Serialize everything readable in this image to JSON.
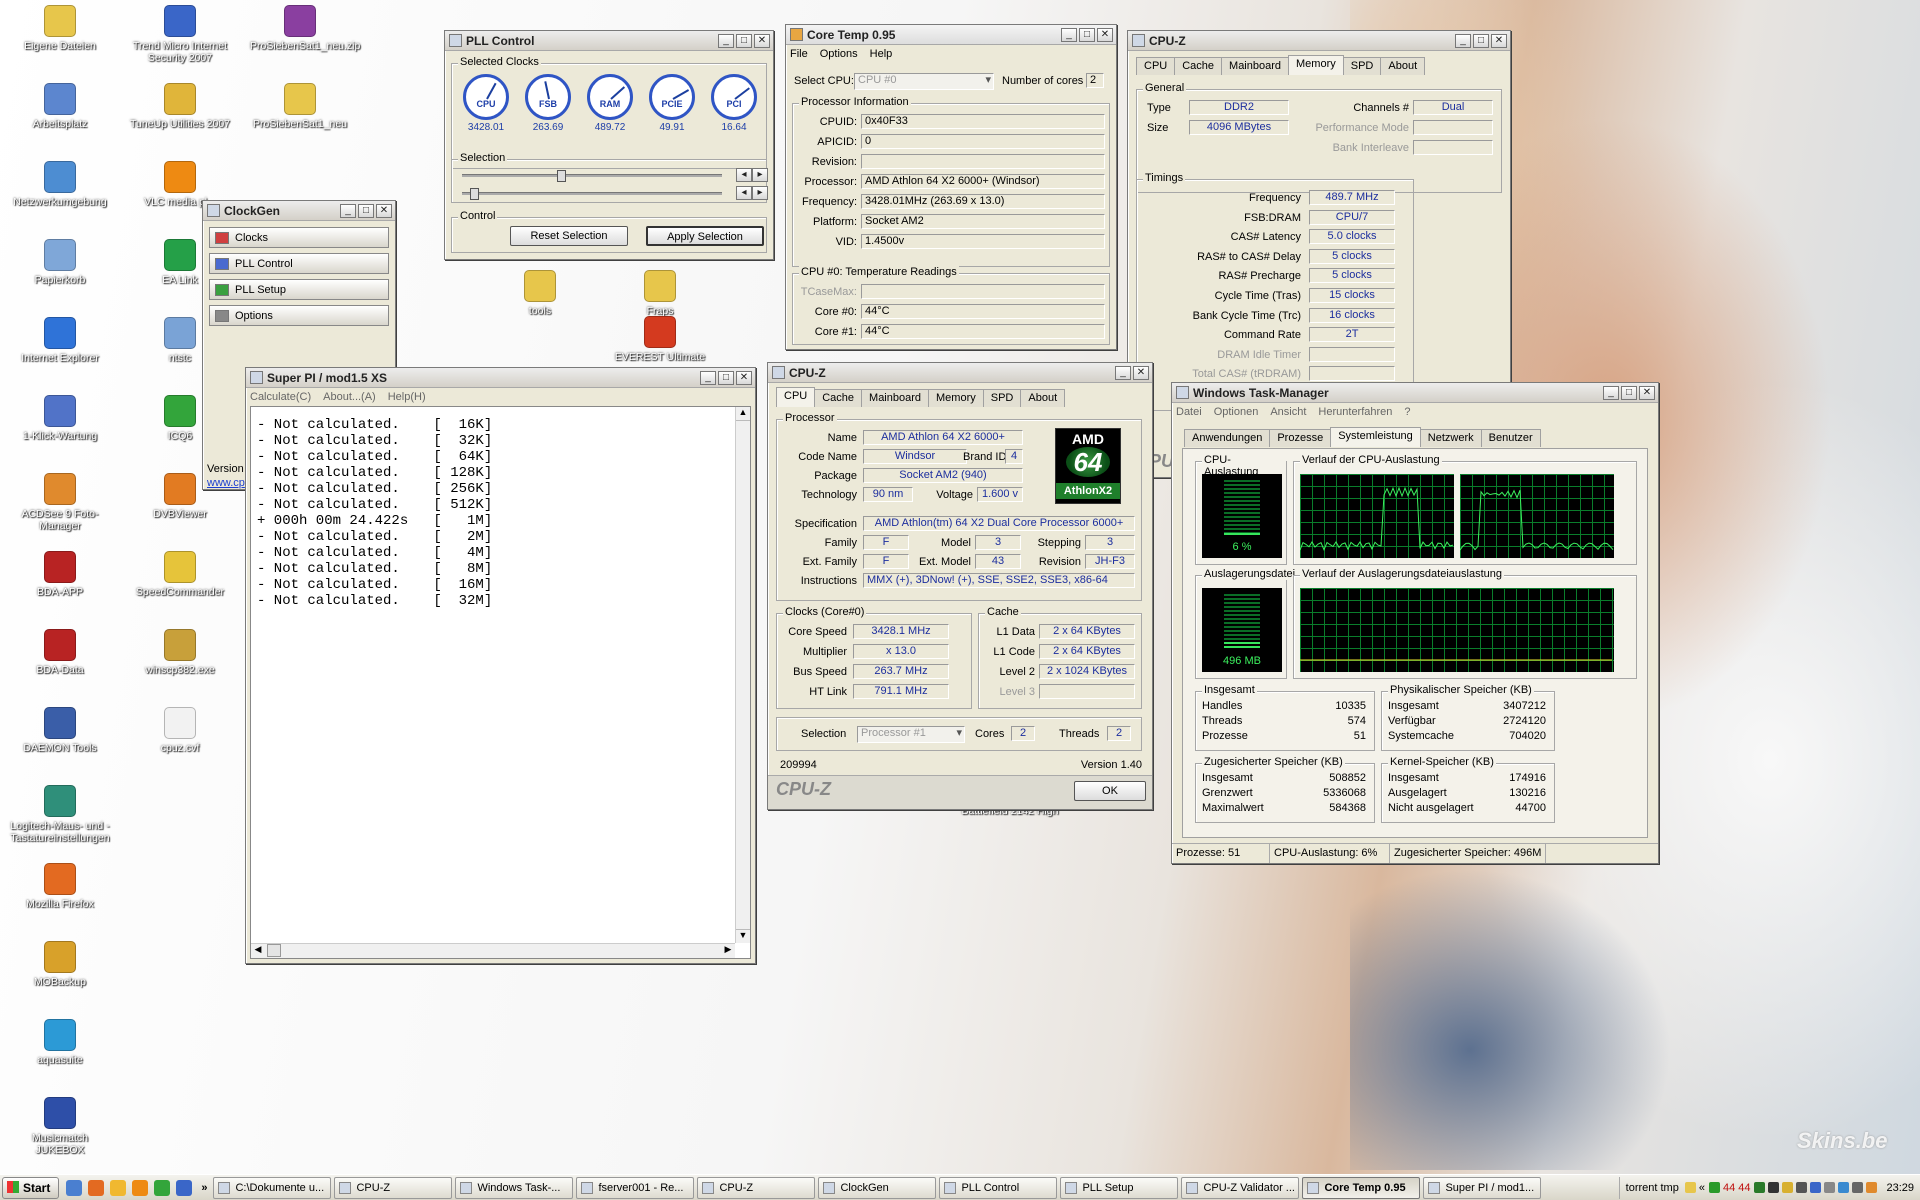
{
  "desktop": {
    "icons": [
      {
        "label": "Eigene Dateien",
        "color": "#e7c64b",
        "glyph": "folder-icon"
      },
      {
        "label": "Arbeitsplatz",
        "color": "#5c86cf",
        "glyph": "computer-icon"
      },
      {
        "label": "Netzwerkumgebung",
        "color": "#4d8dd2",
        "glyph": "network-icon"
      },
      {
        "label": "Papierkorb",
        "color": "#7fa7d8",
        "glyph": "recycle-bin-icon"
      },
      {
        "label": "Internet Explorer",
        "color": "#2f73d8",
        "glyph": "ie-icon"
      },
      {
        "label": "1-Klick-Wartung",
        "color": "#5173c8",
        "glyph": "wrench-icon"
      },
      {
        "label": "ACDSee 9 Foto-Manager",
        "color": "#e08a2d",
        "glyph": "photo-icon"
      },
      {
        "label": "BDA-APP",
        "color": "#b82323",
        "glyph": "app-icon"
      },
      {
        "label": "BDA-Data",
        "color": "#b82323",
        "glyph": "app-icon"
      },
      {
        "label": "DAEMON Tools",
        "color": "#3a5ea8",
        "glyph": "daemon-icon"
      },
      {
        "label": "Logitech-Maus- und -Tastatureinstellungen",
        "color": "#2f8f7a",
        "glyph": "mouse-icon"
      },
      {
        "label": "Mozilla Firefox",
        "color": "#e36a21",
        "glyph": "firefox-icon"
      },
      {
        "label": "MOBackup",
        "color": "#d8a12a",
        "glyph": "backup-icon"
      },
      {
        "label": "aquasuite",
        "color": "#2c9ad6",
        "glyph": "aqua-icon"
      },
      {
        "label": "Musicmatch JUKEBOX",
        "color": "#2e4fa8",
        "glyph": "music-icon"
      },
      {
        "label": "Trend Micro Internet Security 2007",
        "color": "#3a66c8",
        "glyph": "shield-icon"
      },
      {
        "label": "TuneUp Utilities 2007",
        "color": "#e0b53a",
        "glyph": "tuneup-icon"
      },
      {
        "label": "VLC media pl...",
        "color": "#ee8a12",
        "glyph": "vlc-icon"
      },
      {
        "label": "EA Link",
        "color": "#25a048",
        "glyph": "ea-icon"
      },
      {
        "label": "ntstc",
        "color": "#7aa3d6",
        "glyph": "app-icon"
      },
      {
        "label": "ICQ6",
        "color": "#33a53b",
        "glyph": "icq-icon"
      },
      {
        "label": "DVBViewer",
        "color": "#e27b22",
        "glyph": "tv-icon"
      },
      {
        "label": "SpeedCommander",
        "color": "#e6c43a",
        "glyph": "speed-icon"
      },
      {
        "label": "winscp382.exe",
        "color": "#c8a03a",
        "glyph": "exe-icon"
      },
      {
        "label": "cpuz.cvf",
        "color": "#f2f2f2",
        "glyph": "file-icon"
      },
      {
        "label": "ProSiebenSat1_neu.zip",
        "color": "#8a3fa0",
        "glyph": "zip-icon"
      },
      {
        "label": "ProSiebenSat1_neu",
        "color": "#e7c64b",
        "glyph": "folder-icon"
      },
      {
        "label": "tools",
        "color": "#e7c64b",
        "glyph": "folder-icon"
      },
      {
        "label": "Fraps",
        "color": "#e7c64b",
        "glyph": "fraps-icon"
      },
      {
        "label": "EVEREST Ultimate",
        "color": "#d43a1f",
        "glyph": "everest-icon"
      },
      {
        "label": "Battlefield 2142 High",
        "color": "#6a6a6a",
        "glyph": "game-icon"
      }
    ],
    "watermark": "Skins.be"
  },
  "pll": {
    "title": "PLL Control",
    "selected_clocks": "Selected Clocks",
    "gauges": [
      {
        "label": "CPU",
        "value": "3428.01",
        "level": 0.62
      },
      {
        "label": "FSB",
        "value": "263.69",
        "level": 0.45
      },
      {
        "label": "RAM",
        "value": "489.72",
        "level": 0.7
      },
      {
        "label": "PCIE",
        "value": "49.91",
        "level": 0.75
      },
      {
        "label": "PCI",
        "value": "16.64",
        "level": 0.72
      }
    ],
    "selection": "Selection",
    "control": "Control",
    "reset": "Reset Selection",
    "apply": "Apply Selection",
    "slider1": 0.38,
    "slider2": 0.03
  },
  "clockgen": {
    "title": "ClockGen",
    "items": [
      "Clocks",
      "PLL Control",
      "PLL Setup",
      "Options"
    ],
    "version": "Version",
    "link": "www.cp"
  },
  "coretemp": {
    "title": "Core Temp 0.95",
    "menu": [
      "File",
      "Options",
      "Help"
    ],
    "select_cpu": "Select CPU:",
    "cpu_value": "CPU #0",
    "num_cores": "Number of cores",
    "cores": "2",
    "proc_info": "Processor Information",
    "rows": [
      {
        "k": "CPUID:",
        "v": "0x40F33"
      },
      {
        "k": "APICID:",
        "v": "0"
      },
      {
        "k": "Revision:",
        "v": ""
      },
      {
        "k": "Processor:",
        "v": "AMD Athlon 64 X2 6000+ (Windsor)"
      },
      {
        "k": "Frequency:",
        "v": "3428.01MHz (263.69 x 13.0)"
      },
      {
        "k": "Platform:",
        "v": "Socket AM2"
      },
      {
        "k": "VID:",
        "v": "1.4500v"
      }
    ],
    "temps_title": "CPU #0: Temperature Readings",
    "temps": [
      {
        "k": "TCaseMax:",
        "v": ""
      },
      {
        "k": "Core #0:",
        "v": "44°C"
      },
      {
        "k": "Core #1:",
        "v": "44°C"
      }
    ]
  },
  "cpuz_mem": {
    "title": "CPU-Z",
    "tabs": [
      "CPU",
      "Cache",
      "Mainboard",
      "Memory",
      "SPD",
      "About"
    ],
    "general": "General",
    "type_k": "Type",
    "type_v": "DDR2",
    "size_k": "Size",
    "size_v": "4096 MBytes",
    "channels_k": "Channels #",
    "channels_v": "Dual",
    "perf_k": "Performance Mode",
    "bank_k": "Bank Interleave",
    "timings": "Timings",
    "rows": [
      {
        "k": "Frequency",
        "v": "489.7 MHz"
      },
      {
        "k": "FSB:DRAM",
        "v": "CPU/7"
      },
      {
        "k": "CAS# Latency",
        "v": "5.0 clocks"
      },
      {
        "k": "RAS# to CAS# Delay",
        "v": "5 clocks"
      },
      {
        "k": "RAS# Precharge",
        "v": "5 clocks"
      },
      {
        "k": "Cycle Time (Tras)",
        "v": "15 clocks"
      },
      {
        "k": "Bank Cycle Time (Trc)",
        "v": "16 clocks"
      },
      {
        "k": "Command Rate",
        "v": "2T"
      },
      {
        "k": "DRAM Idle Timer",
        "v": ""
      },
      {
        "k": "Total CAS# (tRDRAM)",
        "v": ""
      }
    ],
    "footer": "CPU"
  },
  "superpi": {
    "title": "Super PI / mod1.5 XS",
    "menu": [
      "Calculate(C)",
      "About...(A)",
      "Help(H)"
    ],
    "lines": [
      "- Not calculated.    [  16K]",
      "- Not calculated.    [  32K]",
      "- Not calculated.    [  64K]",
      "- Not calculated.    [ 128K]",
      "- Not calculated.    [ 256K]",
      "- Not calculated.    [ 512K]",
      "+ 000h 00m 24.422s   [   1M]",
      "- Not calculated.    [   2M]",
      "- Not calculated.    [   4M]",
      "- Not calculated.    [   8M]",
      "- Not calculated.    [  16M]",
      "- Not calculated.    [  32M]"
    ]
  },
  "cpuz": {
    "title": "CPU-Z",
    "tabs": [
      "CPU",
      "Cache",
      "Mainboard",
      "Memory",
      "SPD",
      "About"
    ],
    "processor": "Processor",
    "name_k": "Name",
    "name_v": "AMD Athlon 64 X2 6000+",
    "code_k": "Code Name",
    "code_v": "Windsor",
    "brand_k": "Brand ID",
    "brand_v": "4",
    "pkg_k": "Package",
    "pkg_v": "Socket AM2 (940)",
    "tech_k": "Technology",
    "tech_v": "90 nm",
    "volt_k": "Voltage",
    "volt_v": "1.600 v",
    "spec_k": "Specification",
    "spec_v": "AMD Athlon(tm) 64 X2 Dual Core Processor 6000+",
    "fam_k": "Family",
    "fam_v": "F",
    "model_k": "Model",
    "model_v": "3",
    "step_k": "Stepping",
    "step_v": "3",
    "efam_k": "Ext. Family",
    "efam_v": "F",
    "emodel_k": "Ext. Model",
    "emodel_v": "43",
    "rev_k": "Revision",
    "rev_v": "JH-F3",
    "inst_k": "Instructions",
    "inst_v": "MMX (+), 3DNow! (+), SSE, SSE2, SSE3, x86-64",
    "clocks": "Clocks (Core#0)",
    "core_k": "Core Speed",
    "core_v": "3428.1 MHz",
    "mult_k": "Multiplier",
    "mult_v": "x 13.0",
    "bus_k": "Bus Speed",
    "bus_v": "263.7 MHz",
    "ht_k": "HT Link",
    "ht_v": "791.1 MHz",
    "cache": "Cache",
    "l1d_k": "L1 Data",
    "l1d_v": "2 x 64 KBytes",
    "l1c_k": "L1 Code",
    "l1c_v": "2 x 64 KBytes",
    "l2_k": "Level 2",
    "l2_v": "2 x 1024 KBytes",
    "l3_k": "Level 3",
    "l3_v": "",
    "sel_k": "Selection",
    "sel_v": "Processor #1",
    "cores_k": "Cores",
    "cores_v": "2",
    "threads_k": "Threads",
    "threads_v": "2",
    "id": "209994",
    "version": "Version 1.40",
    "brand": "CPU-Z",
    "ok": "OK",
    "logo_top": "AMD",
    "logo_mid": "64",
    "logo_bot": "AthlonX2"
  },
  "taskmgr": {
    "title": "Windows Task-Manager",
    "menu": [
      "Datei",
      "Optionen",
      "Ansicht",
      "Herunterfahren",
      "?"
    ],
    "tabs": [
      "Anwendungen",
      "Prozesse",
      "Systemleistung",
      "Netzwerk",
      "Benutzer"
    ],
    "cpu_usage": "CPU-Auslastung",
    "cpu_val": "6 %",
    "cpu_level": 0.06,
    "cpu_hist": "Verlauf der CPU-Auslastung",
    "pf": "Auslagerungsdatei",
    "pf_val": "496 MB",
    "pf_level": 0.14,
    "pf_hist": "Verlauf der Auslagerungsdateiauslastung",
    "totals": {
      "title": "Insgesamt",
      "rows": [
        {
          "k": "Handles",
          "v": "10335"
        },
        {
          "k": "Threads",
          "v": "574"
        },
        {
          "k": "Prozesse",
          "v": "51"
        }
      ]
    },
    "phys": {
      "title": "Physikalischer Speicher (KB)",
      "rows": [
        {
          "k": "Insgesamt",
          "v": "3407212"
        },
        {
          "k": "Verfügbar",
          "v": "2724120"
        },
        {
          "k": "Systemcache",
          "v": "704020"
        }
      ]
    },
    "commit": {
      "title": "Zugesicherter Speicher (KB)",
      "rows": [
        {
          "k": "Insgesamt",
          "v": "508852"
        },
        {
          "k": "Grenzwert",
          "v": "5336068"
        },
        {
          "k": "Maximalwert",
          "v": "584368"
        }
      ]
    },
    "kernel": {
      "title": "Kernel-Speicher (KB)",
      "rows": [
        {
          "k": "Insgesamt",
          "v": "174916"
        },
        {
          "k": "Ausgelagert",
          "v": "130216"
        },
        {
          "k": "Nicht ausgelagert",
          "v": "44700"
        }
      ]
    },
    "status": [
      "Prozesse: 51",
      "CPU-Auslastung: 6%",
      "Zugesicherter Speicher: 496M"
    ]
  },
  "taskbar": {
    "start": "Start",
    "tasks": [
      {
        "label": "C:\\Dokumente u...",
        "active": false
      },
      {
        "label": "CPU-Z",
        "active": false
      },
      {
        "label": "Windows Task-...",
        "active": false
      },
      {
        "label": "fserver001 - Re...",
        "active": false
      },
      {
        "label": "CPU-Z",
        "active": false
      },
      {
        "label": "ClockGen",
        "active": false
      },
      {
        "label": "PLL Control",
        "active": false
      },
      {
        "label": "PLL Setup",
        "active": false
      },
      {
        "label": "CPU-Z Validator ...",
        "active": false
      },
      {
        "label": "Core Temp 0.95",
        "active": true
      },
      {
        "label": "Super PI / mod1...",
        "active": false
      }
    ],
    "tray_label": "torrent tmp",
    "tray_nums": [
      "44",
      "44"
    ],
    "clock": "23:29"
  }
}
